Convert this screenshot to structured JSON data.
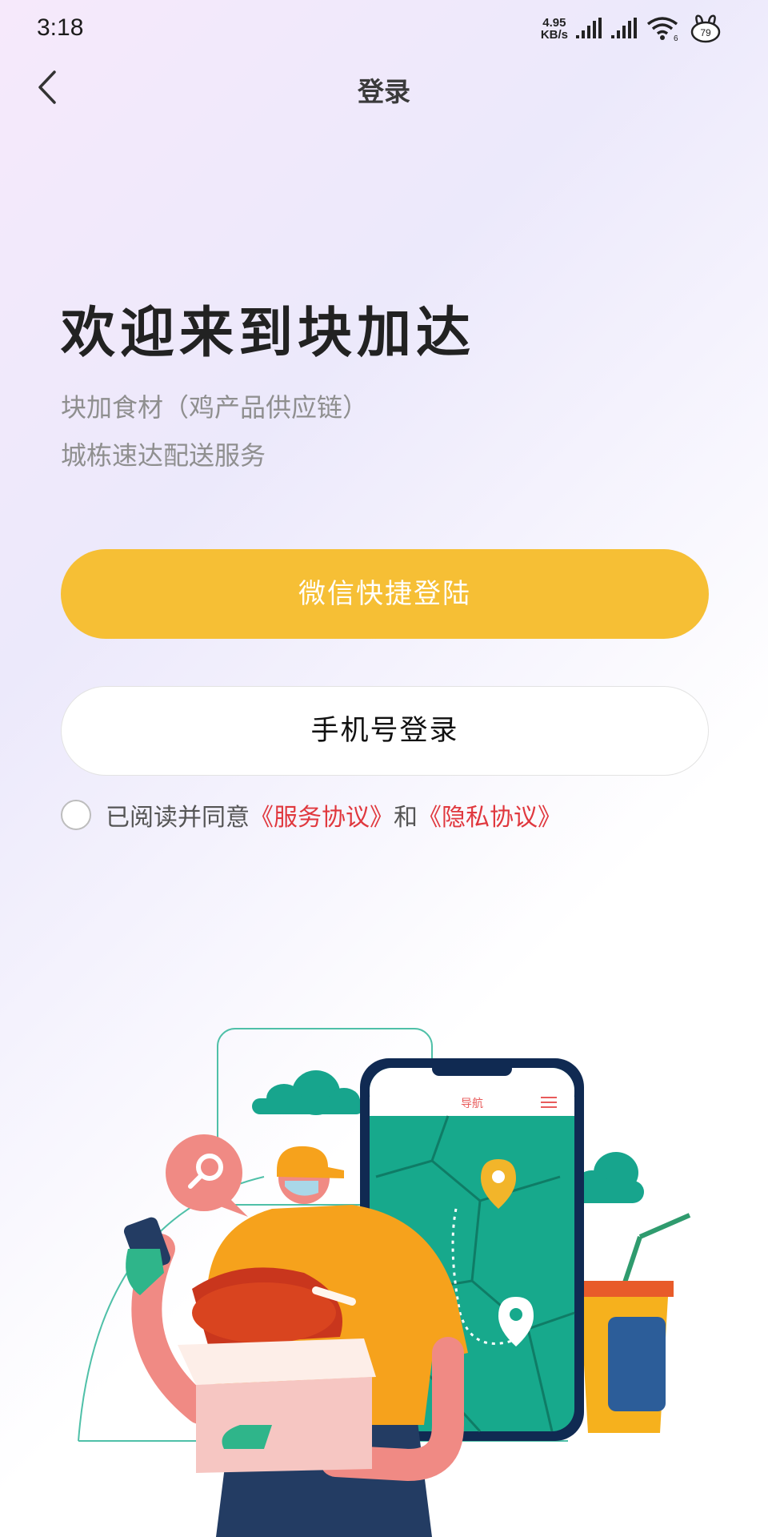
{
  "status_bar": {
    "time": "3:18",
    "net_speed_value": "4.95",
    "net_speed_unit": "KB/s",
    "icons": [
      "signal-icon",
      "signal-icon",
      "wifi-icon",
      "pet-icon"
    ],
    "wifi_sub": "6",
    "pet_badge": "79"
  },
  "nav": {
    "title": "登录"
  },
  "welcome": {
    "title": "欢迎来到块加达",
    "line1": "块加食材（鸡产品供应链）",
    "line2": "城栋速达配送服务"
  },
  "buttons": {
    "wechat_login": "微信快捷登陆",
    "phone_login": "手机号登录"
  },
  "agreement": {
    "prefix": "已阅读并同意",
    "service_link": "《服务协议》",
    "conjunction": "和",
    "privacy_link": "《隐私协议》"
  },
  "illustration": {
    "phone_header": "导航"
  },
  "colors": {
    "primary_button": "#f6bf35",
    "link": "#e0383e",
    "map_green": "#14a98c"
  }
}
